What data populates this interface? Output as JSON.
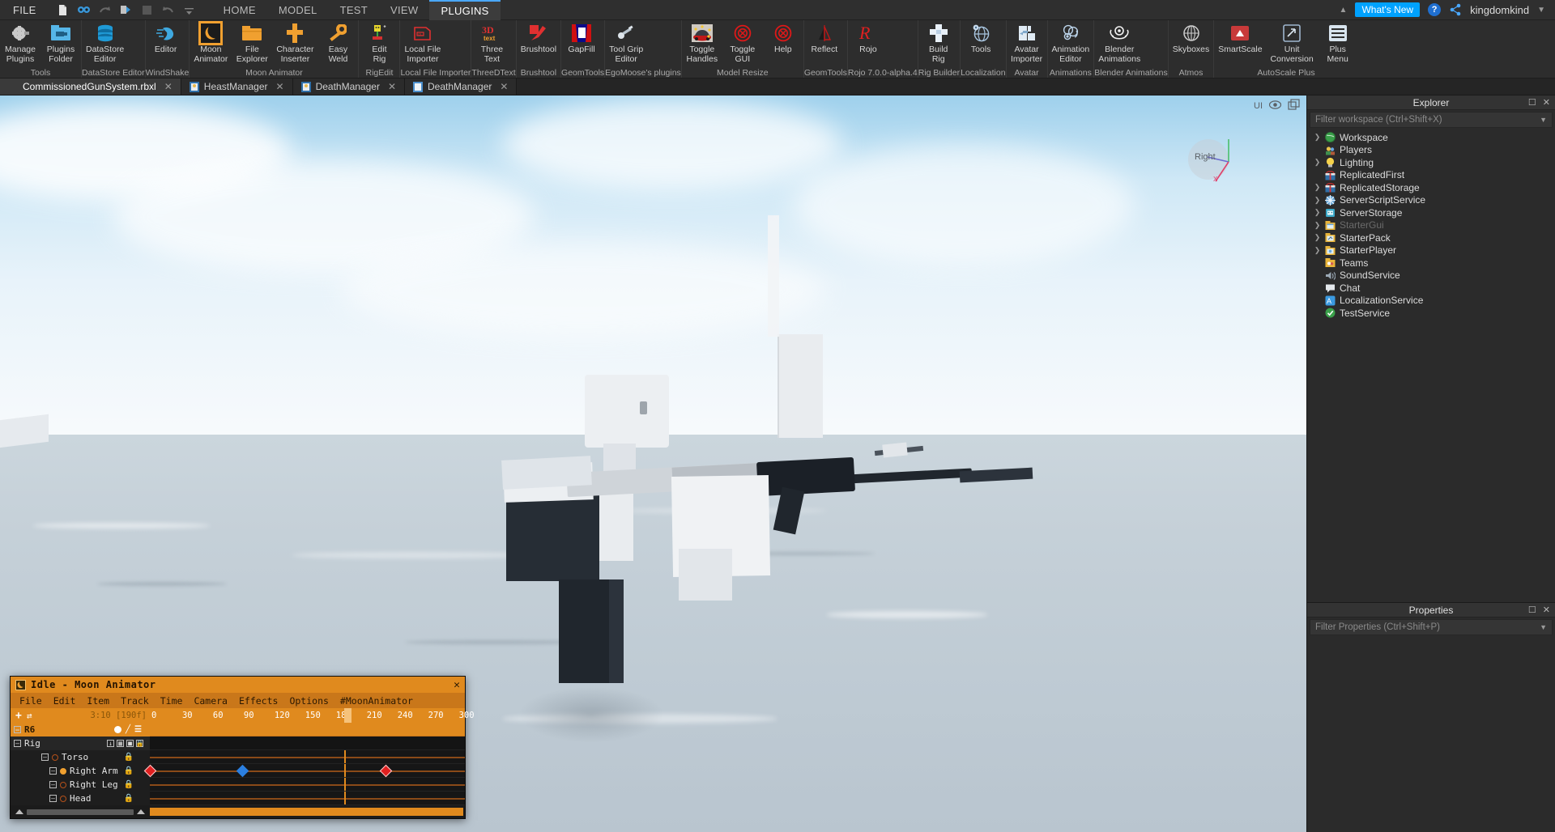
{
  "menubar": {
    "file_label": "FILE",
    "quick_icons": [
      "new-file-icon",
      "search-icon",
      "redo-icon",
      "play-icon",
      "stop-icon",
      "undo-icon",
      "more-options-icon"
    ],
    "tabs": [
      {
        "label": "HOME",
        "active": false
      },
      {
        "label": "MODEL",
        "active": false
      },
      {
        "label": "TEST",
        "active": false
      },
      {
        "label": "VIEW",
        "active": false
      },
      {
        "label": "PLUGINS",
        "active": true
      }
    ],
    "whats_new": "What's New",
    "help_label": "?",
    "username": "kingdomkind",
    "accent_blue": "#00a2ff"
  },
  "ribbon": {
    "groups": [
      {
        "name": "Tools",
        "items": [
          {
            "label": "Manage\nPlugins",
            "icon": "gear-plugin-icon",
            "selected": false
          },
          {
            "label": "Plugins\nFolder",
            "icon": "plugins-folder-icon",
            "selected": false
          }
        ]
      },
      {
        "name": "DataStore Editor",
        "items": [
          {
            "label": "DataStore\nEditor",
            "icon": "database-icon",
            "selected": false
          }
        ]
      },
      {
        "name": "WindShake",
        "items": [
          {
            "label": "Editor",
            "icon": "wind-icon",
            "selected": false
          }
        ]
      },
      {
        "name": "Moon Animator",
        "items": [
          {
            "label": "Moon\nAnimator",
            "icon": "moon-icon",
            "selected": true
          },
          {
            "label": "File\nExplorer",
            "icon": "folder-icon",
            "selected": false
          },
          {
            "label": "Character\nInserter",
            "icon": "character-icon",
            "selected": false
          },
          {
            "label": "Easy\nWeld",
            "icon": "wrench-icon",
            "selected": false
          }
        ]
      },
      {
        "name": "RigEdit",
        "items": [
          {
            "label": "Edit\nRig",
            "icon": "edit-rig-icon",
            "selected": false
          }
        ]
      },
      {
        "name": "Local File Importer",
        "items": [
          {
            "label": "Local File\nImporter",
            "icon": "file-import-icon",
            "selected": false
          }
        ]
      },
      {
        "name": "ThreeDText",
        "items": [
          {
            "label": "Three\nText",
            "icon": "3d-text-icon",
            "selected": false
          }
        ]
      },
      {
        "name": "Brushtool",
        "items": [
          {
            "label": "Brushtool",
            "icon": "brush-icon",
            "selected": false
          }
        ]
      },
      {
        "name": "GeomTools",
        "items": [
          {
            "label": "GapFill",
            "icon": "gapfill-icon",
            "selected": false
          }
        ]
      },
      {
        "name": "EgoMoose's plugins",
        "items": [
          {
            "label": "Tool Grip\nEditor",
            "icon": "tool-grip-icon",
            "selected": false
          }
        ]
      },
      {
        "name": "Model Resize",
        "items": [
          {
            "label": "Toggle\nHandles",
            "icon": "toggle-handles-icon",
            "selected": false
          },
          {
            "label": "Toggle\nGUI",
            "icon": "toggle-gui-icon",
            "selected": false
          },
          {
            "label": "Help",
            "icon": "help-circle-icon",
            "selected": false
          }
        ]
      },
      {
        "name": "GeomTools",
        "items": [
          {
            "label": "Reflect",
            "icon": "reflect-icon",
            "selected": false
          }
        ]
      },
      {
        "name": "Rojo 7.0.0-alpha.4",
        "items": [
          {
            "label": "Rojo",
            "icon": "rojo-icon",
            "selected": false
          }
        ]
      },
      {
        "name": "Rig Builder",
        "items": [
          {
            "label": "Build\nRig",
            "icon": "build-rig-icon",
            "selected": false
          }
        ]
      },
      {
        "name": "Localization",
        "items": [
          {
            "label": "Tools",
            "icon": "globe-icon",
            "selected": false
          }
        ]
      },
      {
        "name": "Avatar",
        "items": [
          {
            "label": "Avatar\nImporter",
            "icon": "avatar-import-icon",
            "selected": false
          }
        ]
      },
      {
        "name": "Animations",
        "items": [
          {
            "label": "Animation\nEditor",
            "icon": "animation-editor-icon",
            "selected": false
          }
        ]
      },
      {
        "name": "Blender Animations",
        "items": [
          {
            "label": "Blender\nAnimations",
            "icon": "blender-icon",
            "selected": false
          }
        ]
      },
      {
        "name": "Atmos",
        "items": [
          {
            "label": "Skyboxes",
            "icon": "skybox-icon",
            "selected": false
          }
        ]
      },
      {
        "name": "AutoScale Plus",
        "items": [
          {
            "label": "SmartScale",
            "icon": "smartscale-icon",
            "selected": false
          },
          {
            "label": "Unit\nConversion",
            "icon": "unit-conversion-icon",
            "selected": false
          },
          {
            "label": "Plus\nMenu",
            "icon": "plus-menu-icon",
            "selected": false
          }
        ]
      }
    ]
  },
  "doctabs": [
    {
      "label": "CommissionedGunSystem.rbxl",
      "icon": "place-icon",
      "active": true
    },
    {
      "label": "HeastManager",
      "icon": "script-icon",
      "active": false
    },
    {
      "label": "DeathManager",
      "icon": "script-icon",
      "active": false
    },
    {
      "label": "DeathManager",
      "icon": "modulescript-icon",
      "active": false
    }
  ],
  "viewport": {
    "ui_toggle_label": "UI",
    "eye_icon": "eye-icon",
    "fullscreen_icon": "fullscreen-icon",
    "gizmo_label": "Right",
    "gizmo_axes": [
      "X",
      "Y",
      "Z"
    ]
  },
  "moon_animator": {
    "title": "Idle - Moon Animator",
    "title_icon": "moon-icon",
    "close_icon": "close-icon",
    "menu": [
      "File",
      "Edit",
      "Item",
      "Track",
      "Time",
      "Camera",
      "Effects",
      "Options",
      "#MoonAnimator"
    ],
    "timecode": "3:10 [190f]",
    "add_icon": "plus-icon",
    "loop_icon": "loop-icon",
    "ruler_ticks": [
      "0",
      "30",
      "60",
      "90",
      "120",
      "150",
      "180",
      "210",
      "240",
      "270",
      "300"
    ],
    "playhead_frame": 190,
    "rig_root": {
      "label": "R6",
      "icons": [
        "record-dot-icon",
        "tween-icon",
        "menu-icon"
      ]
    },
    "rig_group": {
      "label": "Rig",
      "icons": [
        "import-icon",
        "columns-icon",
        "square-icon",
        "lock-icon"
      ]
    },
    "tracks": [
      {
        "label": "Torso",
        "dot": "hollow",
        "lock": "lock-icon",
        "keyframes": []
      },
      {
        "label": "Right Arm",
        "dot": "filled",
        "lock": "lock-icon",
        "keyframes": [
          {
            "frame": 0,
            "color": "red"
          },
          {
            "frame": 90,
            "color": "blue"
          },
          {
            "frame": 230,
            "color": "red"
          }
        ]
      },
      {
        "label": "Right Leg",
        "dot": "hollow",
        "lock": "lock-icon",
        "keyframes": []
      },
      {
        "label": "Head",
        "dot": "hollow",
        "lock": "lock-icon",
        "keyframes": []
      }
    ]
  },
  "explorer": {
    "title": "Explorer",
    "filter_placeholder": "Filter workspace (Ctrl+Shift+X)",
    "items": [
      {
        "label": "Workspace",
        "icon": "workspace-icon",
        "expandable": true,
        "dim": false
      },
      {
        "label": "Players",
        "icon": "players-icon",
        "expandable": false,
        "dim": false
      },
      {
        "label": "Lighting",
        "icon": "lighting-icon",
        "expandable": true,
        "dim": false
      },
      {
        "label": "ReplicatedFirst",
        "icon": "replicated-first-icon",
        "expandable": false,
        "dim": false
      },
      {
        "label": "ReplicatedStorage",
        "icon": "replicated-storage-icon",
        "expandable": true,
        "dim": false
      },
      {
        "label": "ServerScriptService",
        "icon": "server-script-service-icon",
        "expandable": true,
        "dim": false
      },
      {
        "label": "ServerStorage",
        "icon": "server-storage-icon",
        "expandable": true,
        "dim": false
      },
      {
        "label": "StarterGui",
        "icon": "starter-gui-icon",
        "expandable": true,
        "dim": true
      },
      {
        "label": "StarterPack",
        "icon": "starter-pack-icon",
        "expandable": true,
        "dim": false
      },
      {
        "label": "StarterPlayer",
        "icon": "starter-player-icon",
        "expandable": true,
        "dim": false
      },
      {
        "label": "Teams",
        "icon": "teams-icon",
        "expandable": false,
        "dim": false
      },
      {
        "label": "SoundService",
        "icon": "sound-service-icon",
        "expandable": false,
        "dim": false
      },
      {
        "label": "Chat",
        "icon": "chat-icon",
        "expandable": false,
        "dim": false
      },
      {
        "label": "LocalizationService",
        "icon": "localization-icon",
        "expandable": false,
        "dim": false
      },
      {
        "label": "TestService",
        "icon": "test-service-icon",
        "expandable": false,
        "dim": false
      }
    ]
  },
  "properties": {
    "title": "Properties",
    "filter_placeholder": "Filter Properties (Ctrl+Shift+P)"
  }
}
